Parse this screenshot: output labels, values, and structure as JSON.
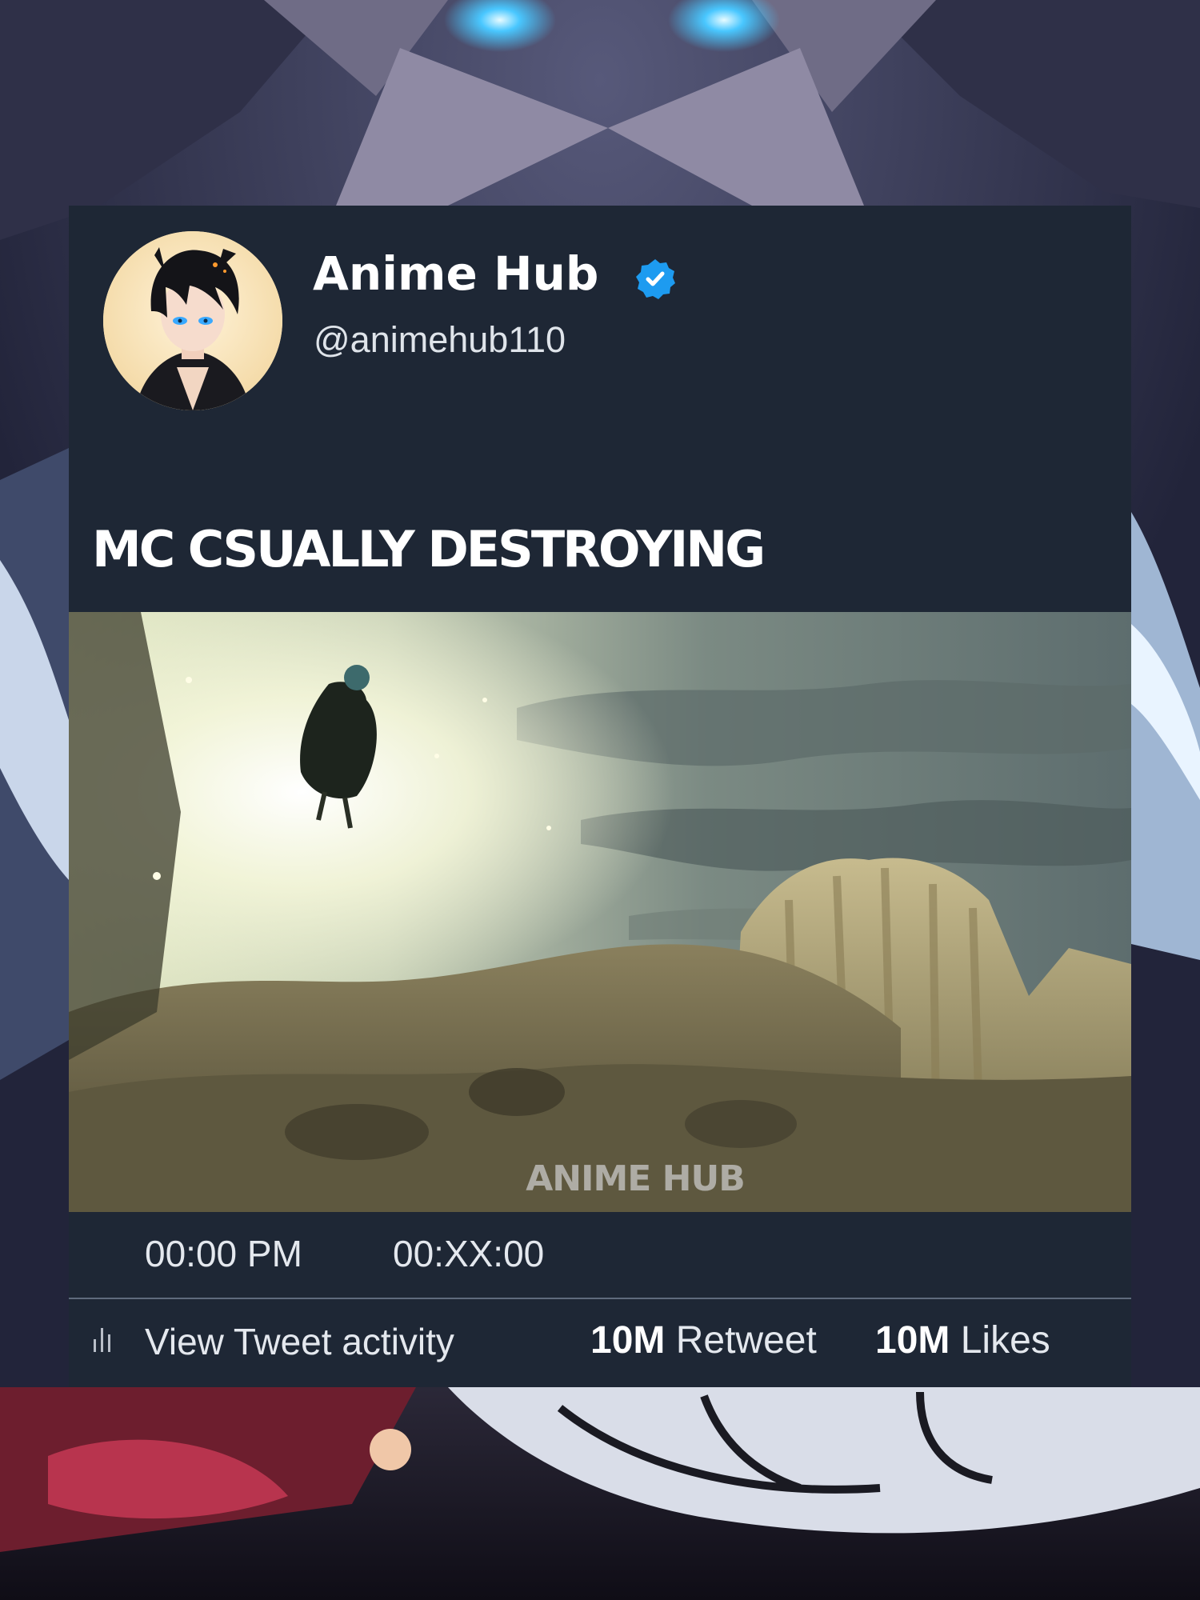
{
  "author": {
    "display_name": "Anime Hub",
    "handle": "@animehub110",
    "verified": true
  },
  "tweet": {
    "text": "MC CSUALLY DESTROYING",
    "media_watermark": "ANIME HUB"
  },
  "meta": {
    "time": "00:00 PM",
    "date": "00:XX:00"
  },
  "actions": {
    "activity_label": "View Tweet activity",
    "retweets_count": "10M",
    "retweets_label": "Retweet",
    "likes_count": "10M",
    "likes_label": "Likes"
  },
  "colors": {
    "card_background": "#1e2735",
    "verified_badge": "#1d9bf0",
    "text_primary": "#ffffff",
    "text_secondary": "#e4e8ee"
  },
  "icons": {
    "verified": "verified-badge-icon",
    "activity": "bar-chart-icon"
  }
}
